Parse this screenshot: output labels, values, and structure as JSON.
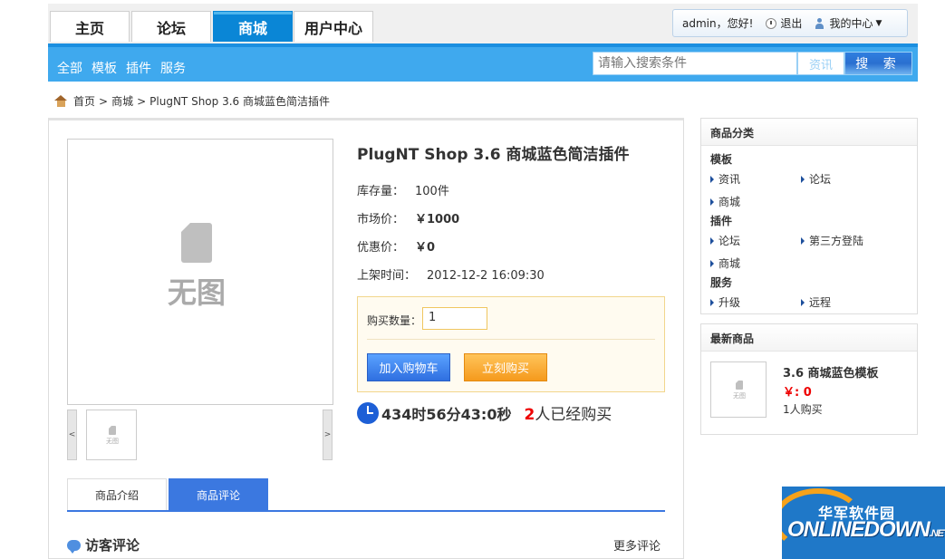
{
  "nav": {
    "tabs": [
      {
        "label": "主页"
      },
      {
        "label": "论坛"
      },
      {
        "label": "商城"
      },
      {
        "label": "用户中心"
      }
    ]
  },
  "user": {
    "greeting": "admin，您好!",
    "logout": "退出",
    "my_center": "我的中心"
  },
  "subnav": {
    "links": [
      "全部",
      "模板",
      "插件",
      "服务"
    ]
  },
  "search": {
    "placeholder": "请输入搜索条件",
    "type": "资讯",
    "button": "搜 索"
  },
  "breadcrumb": {
    "home": "首页",
    "sep": ">",
    "mall": "商城",
    "current": "PlugNT Shop 3.6 商城蓝色简洁插件"
  },
  "product": {
    "no_image": "无图",
    "title": "PlugNT Shop 3.6 商城蓝色简洁插件",
    "stock_label": "库存量：",
    "stock_value": "100件",
    "market_label": "市场价：",
    "market_value": "￥1000",
    "sale_label": "优惠价：",
    "sale_value": "￥0",
    "time_label": "上架时间：",
    "time_value": "2012-12-2 16:09:30",
    "prev": "<",
    "next": ">"
  },
  "buy": {
    "qty_label": "购买数量：",
    "qty_value": "1",
    "add_cart": "加入购物车",
    "buy_now": "立刻购买"
  },
  "timer": {
    "remaining": "434时56分43:0秒",
    "bought_count": "2",
    "bought_suffix": "人已经购买"
  },
  "tabs": [
    {
      "label": "商品介绍"
    },
    {
      "label": "商品评论"
    }
  ],
  "reviews": {
    "title": "访客评论",
    "more": "更多评论"
  },
  "sidebar": {
    "category_title": "商品分类",
    "groups": [
      {
        "name": "模板",
        "items": [
          "资讯",
          "论坛",
          "商城"
        ]
      },
      {
        "name": "插件",
        "items": [
          "论坛",
          "第三方登陆",
          "商城"
        ]
      },
      {
        "name": "服务",
        "items": [
          "升级",
          "远程"
        ]
      }
    ],
    "new_title": "最新商品",
    "new_item": {
      "title": "3.6 商城蓝色模板",
      "price": "￥: 0",
      "sold": "1人购买"
    }
  },
  "watermark": {
    "top": "华军软件园",
    "brand": "ONLINEDOWN",
    "net": ".NET"
  },
  "colors": {
    "accent": "#0a86d6",
    "subbar": "#3fa9ee",
    "tab_active": "#3b78e0",
    "price_red": "#ee0000",
    "buy_orange": "#f59a1d"
  }
}
